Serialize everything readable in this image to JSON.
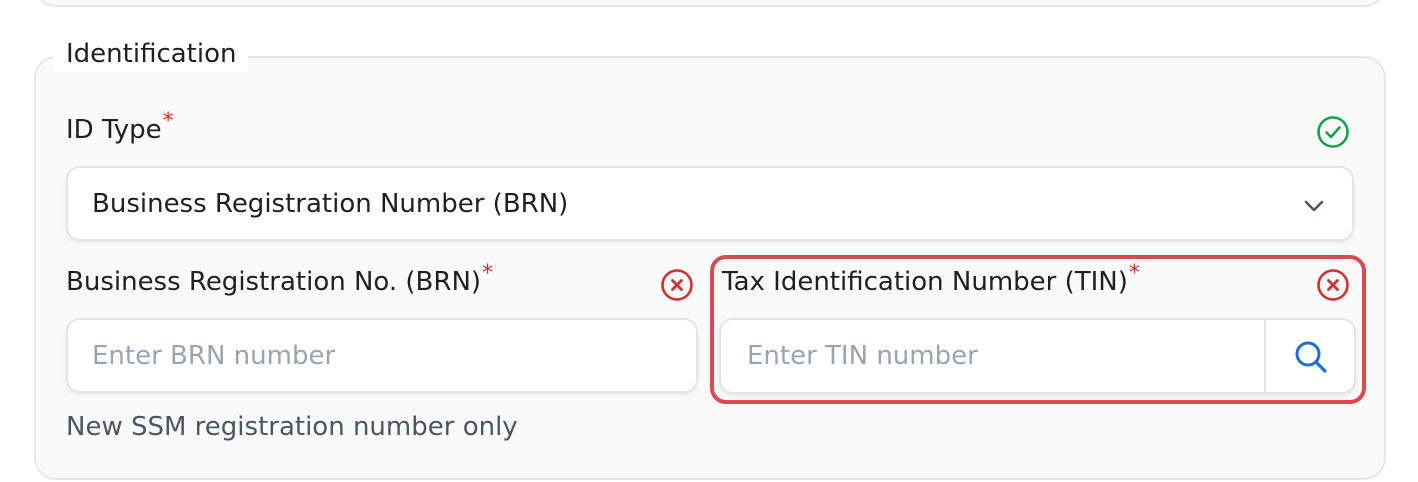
{
  "section": {
    "legend": "Identification"
  },
  "id_type": {
    "label": "ID Type",
    "required_mark": "*",
    "selected_value": "Business Registration Number (BRN)",
    "status_icon": "check-circle-icon"
  },
  "brn": {
    "label": "Business Registration No. (BRN)",
    "required_mark": "*",
    "placeholder": "Enter BRN number",
    "value": "",
    "hint": "New SSM registration number only",
    "status_icon": "error-circle-icon"
  },
  "tin": {
    "label": "Tax Identification Number (TIN)",
    "required_mark": "*",
    "placeholder": "Enter TIN number",
    "value": "",
    "status_icon": "error-circle-icon",
    "search_icon": "search-icon"
  },
  "colors": {
    "required": "#d32f2f",
    "valid": "#16a34a",
    "error": "#d32f2f",
    "highlight": "#dc4a4f",
    "search": "#1d6fd6"
  }
}
